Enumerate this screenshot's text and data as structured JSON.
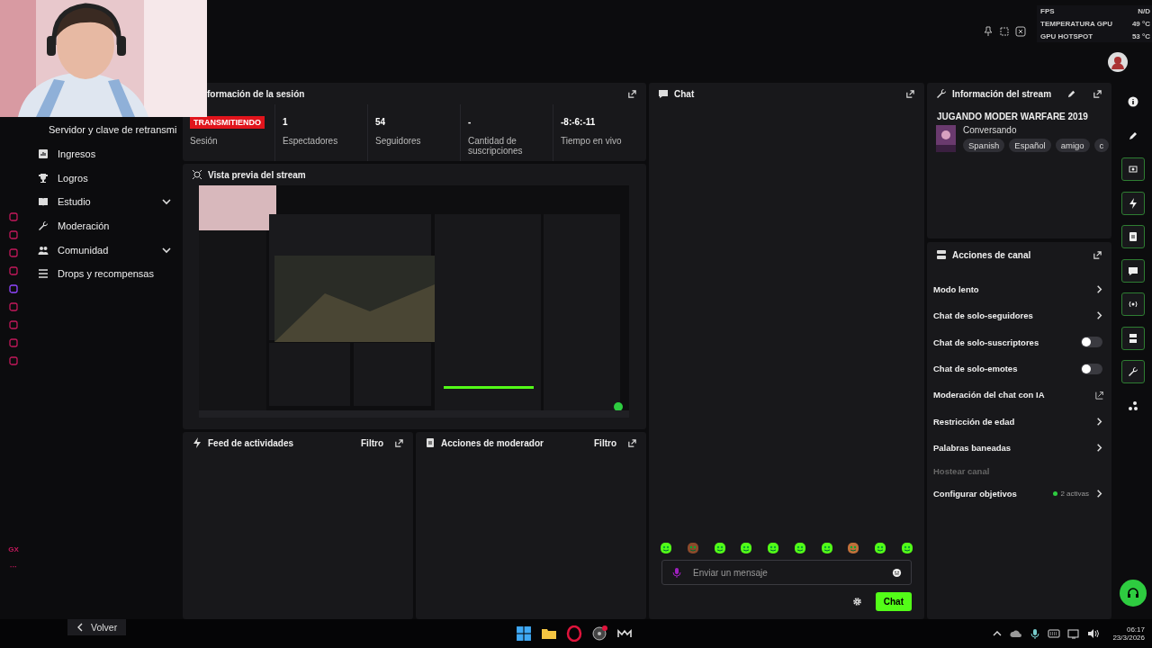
{
  "top_bar": {
    "overlay": [
      {
        "label": "FPS",
        "value": "N/D"
      },
      {
        "label": "TEMPERATURA GPU",
        "value": "49 °C"
      },
      {
        "label": "GPU HOTSPOT",
        "value": "53 °C"
      }
    ]
  },
  "browser_sidebar": {
    "labels": [
      "GX",
      "···"
    ]
  },
  "nav": {
    "items": [
      {
        "label": "Servidor y clave de retransmi",
        "kind": "link"
      },
      {
        "label": "Ingresos",
        "kind": "link"
      },
      {
        "label": "Logros",
        "kind": "link"
      },
      {
        "label": "Estudio",
        "kind": "group",
        "expanded": false
      },
      {
        "label": "Moderación",
        "kind": "link"
      },
      {
        "label": "Comunidad",
        "kind": "group",
        "expanded": false
      },
      {
        "label": "Drops y recompensas",
        "kind": "link"
      }
    ]
  },
  "session": {
    "title": "formación de la sesión",
    "status": {
      "badge": "TRANSMITIENDO",
      "label": "Sesión"
    },
    "stats": [
      {
        "value": "1",
        "label": "Espectadores"
      },
      {
        "value": "54",
        "label": "Seguidores"
      },
      {
        "value": "-",
        "label": "Cantidad de suscripciones"
      },
      {
        "value": "-8:-6:-11",
        "label": "Tiempo en vivo"
      }
    ]
  },
  "preview": {
    "title": "Vista previa del stream"
  },
  "feed": {
    "title": "Feed de actividades",
    "filter": "Filtro"
  },
  "mod_actions": {
    "title": "Acciones de moderador",
    "filter": "Filtro"
  },
  "chat": {
    "title": "Chat",
    "placeholder": "Enviar un mensaje",
    "send": "Chat"
  },
  "stream_info": {
    "title": "Información del stream",
    "stream_title": "JUGANDO MODER WARFARE 2019",
    "category": "Conversando",
    "tags": [
      "Spanish",
      "Español",
      "amigo",
      "c"
    ]
  },
  "channel_actions": {
    "title": "Acciones de canal",
    "items": [
      {
        "label": "Modo lento",
        "kind": "link",
        "disabled": false
      },
      {
        "label": "Chat de solo-seguidores",
        "kind": "link",
        "disabled": false
      },
      {
        "label": "Chat de solo-suscriptores",
        "kind": "toggle",
        "on": false,
        "disabled": false
      },
      {
        "label": "Chat de solo-emotes",
        "kind": "toggle",
        "on": false,
        "disabled": false
      },
      {
        "label": "Moderación del chat con IA",
        "kind": "external",
        "disabled": false
      },
      {
        "label": "Restricción de edad",
        "kind": "link",
        "disabled": false
      },
      {
        "label": "Palabras baneadas",
        "kind": "link",
        "disabled": false
      },
      {
        "label": "Hostear canal",
        "kind": "plain",
        "disabled": true
      },
      {
        "label": "Configurar objetivos",
        "kind": "goal",
        "badge": "2 activas",
        "color": "#2ecc40",
        "disabled": false
      }
    ]
  },
  "footer": {
    "back": "Volver"
  },
  "taskbar": {
    "time": "06:17",
    "date": "23/3/2026"
  }
}
